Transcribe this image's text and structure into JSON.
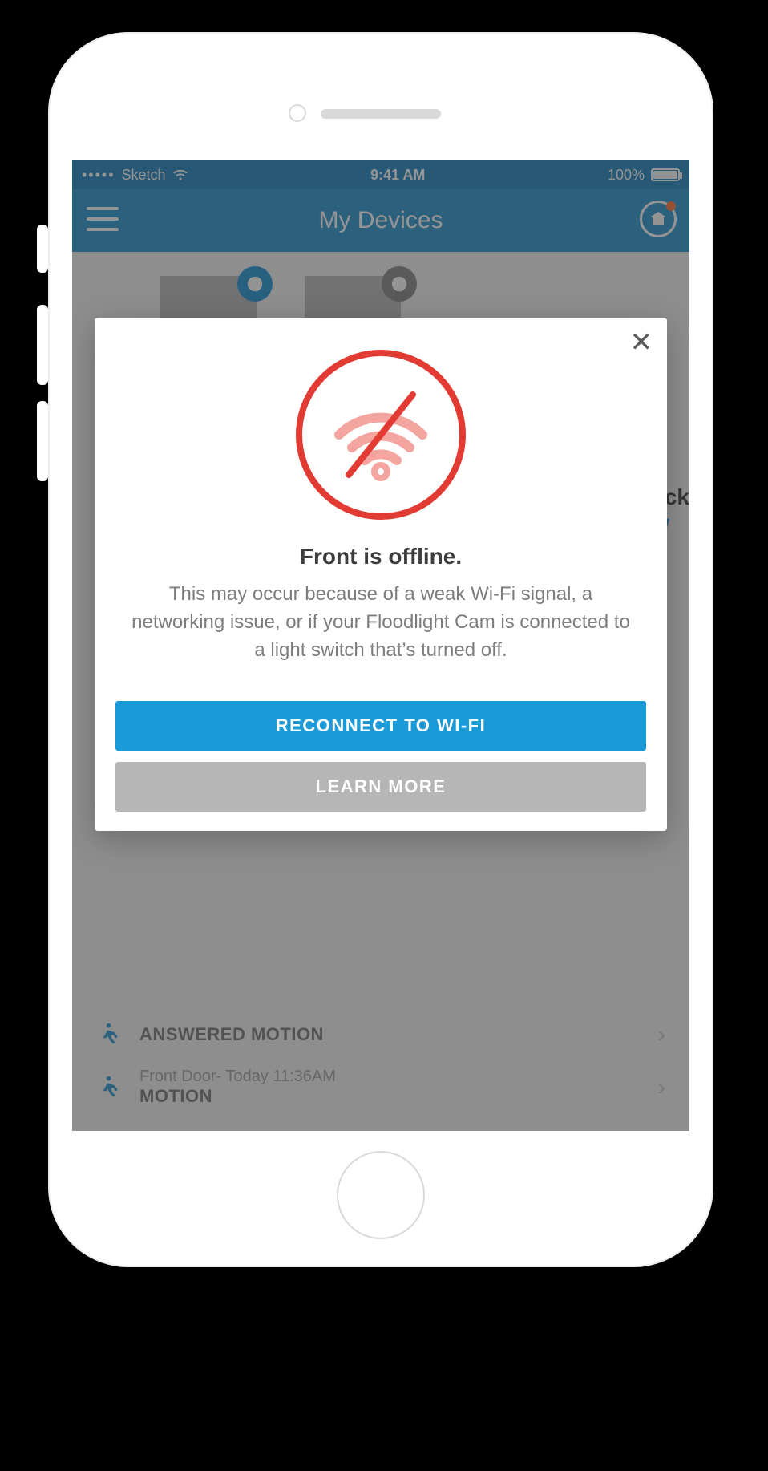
{
  "status_bar": {
    "carrier": "Sketch",
    "time": "9:41 AM",
    "battery_pct": "100%"
  },
  "navbar": {
    "title": "My Devices"
  },
  "peek": {
    "top": "ack",
    "bottom": "w"
  },
  "activity": [
    {
      "line1": "",
      "line2": "ANSWERED MOTION"
    },
    {
      "line1": "Front Door- Today 11:36AM",
      "line2": "MOTION"
    }
  ],
  "modal": {
    "title": "Front is offline.",
    "description": "This may occur because of a weak Wi-Fi signal, a networking issue, or if your Floodlight Cam is connected to a light switch that’s turned off.",
    "primary_button": "RECONNECT TO WI-FI",
    "secondary_button": "LEARN MORE"
  }
}
